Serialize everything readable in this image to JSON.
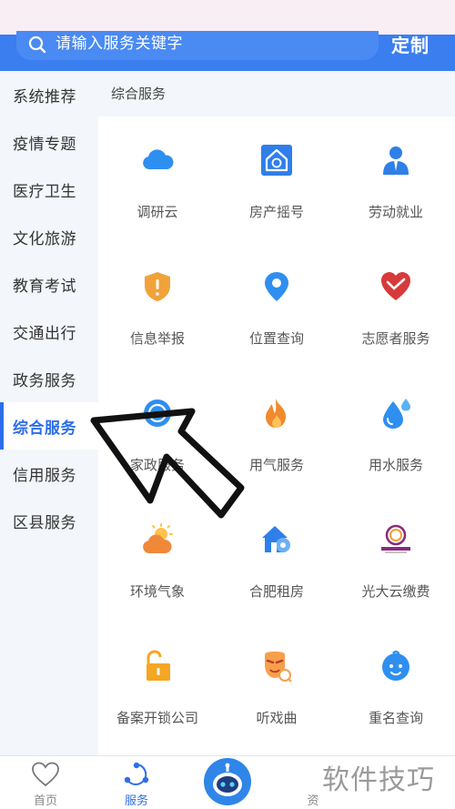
{
  "search": {
    "placeholder": "请输入服务关键字",
    "customize_label": "定制"
  },
  "sidebar": {
    "items": [
      {
        "label": "系统推荐"
      },
      {
        "label": "疫情专题"
      },
      {
        "label": "医疗卫生"
      },
      {
        "label": "文化旅游"
      },
      {
        "label": "教育考试"
      },
      {
        "label": "交通出行"
      },
      {
        "label": "政务服务"
      },
      {
        "label": "综合服务"
      },
      {
        "label": "信用服务"
      },
      {
        "label": "区县服务"
      }
    ],
    "active_index": 7
  },
  "section": {
    "title": "综合服务"
  },
  "services": [
    {
      "label": "调研云",
      "icon": "cloud-icon"
    },
    {
      "label": "房产摇号",
      "icon": "house-lottery-icon"
    },
    {
      "label": "劳动就业",
      "icon": "worker-icon"
    },
    {
      "label": "信息举报",
      "icon": "shield-alert-icon"
    },
    {
      "label": "位置查询",
      "icon": "location-pin-icon"
    },
    {
      "label": "志愿者服务",
      "icon": "heart-hand-icon"
    },
    {
      "label": "家政服务",
      "icon": "housekeeping-icon"
    },
    {
      "label": "用气服务",
      "icon": "flame-icon"
    },
    {
      "label": "用水服务",
      "icon": "water-drop-icon"
    },
    {
      "label": "环境气象",
      "icon": "sun-cloud-icon"
    },
    {
      "label": "合肥租房",
      "icon": "house-key-icon"
    },
    {
      "label": "光大云缴费",
      "icon": "everbright-logo-icon"
    },
    {
      "label": "备案开锁公司",
      "icon": "unlock-icon"
    },
    {
      "label": "听戏曲",
      "icon": "opera-mask-icon"
    },
    {
      "label": "重名查询",
      "icon": "baby-face-icon"
    }
  ],
  "tabbar": {
    "items": [
      {
        "label": "首页",
        "icon": "heart-outline-icon"
      },
      {
        "label": "服务",
        "icon": "service-nodes-icon"
      },
      {
        "label": "",
        "icon": "robot-assistant-icon"
      },
      {
        "label": "资",
        "icon": "message-icon"
      }
    ],
    "active_index": 1
  },
  "watermark": {
    "text": "软件技巧"
  },
  "colors": {
    "accent": "#2d6ee8",
    "header": "#3a7ef0",
    "sidebar_bg": "#f3f6fa"
  }
}
